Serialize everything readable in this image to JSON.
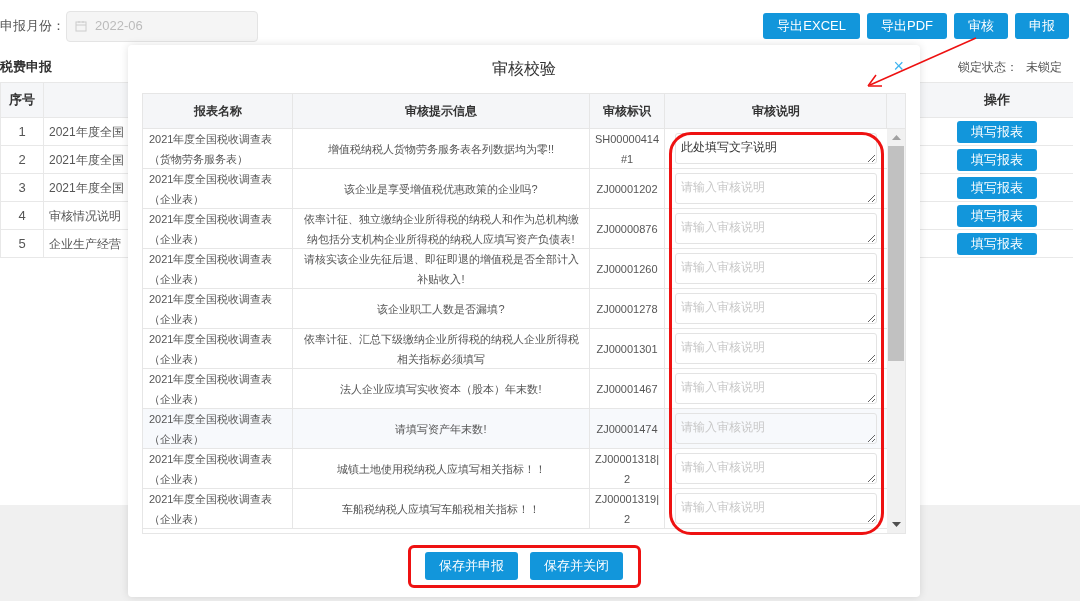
{
  "toolbar": {
    "month_label": "申报月份：",
    "month_value": "2022-06",
    "month_disabled": true,
    "buttons": [
      "导出EXCEL",
      "导出PDF",
      "审核",
      "申报"
    ]
  },
  "section_title": "税费申报",
  "lock": {
    "label": "锁定状态：",
    "value": "未锁定"
  },
  "main_table": {
    "columns": [
      "序号",
      "操作"
    ],
    "rows": [
      {
        "index": "1",
        "name": "2021年度全国",
        "action": "填写报表"
      },
      {
        "index": "2",
        "name": "2021年度全国",
        "action": "填写报表"
      },
      {
        "index": "3",
        "name": "2021年度全国",
        "action": "填写报表"
      },
      {
        "index": "4",
        "name": "审核情况说明",
        "action": "填写报表"
      },
      {
        "index": "5",
        "name": "企业生产经营",
        "action": "填写报表"
      }
    ]
  },
  "dialog": {
    "title": "审核校验",
    "close": "×",
    "columns": [
      "报表名称",
      "审核提示信息",
      "审核标识",
      "审核说明"
    ],
    "rows": [
      {
        "report": "2021年度全国税收调查表（货物劳务服务表）",
        "message": "增值税纳税人货物劳务服务表各列数据均为零!!",
        "code": "SH00000414#1",
        "note_value": "此处填写文字说明"
      },
      {
        "report": "2021年度全国税收调查表（企业表）",
        "message": "该企业是享受增值税优惠政策的企业吗?",
        "code": "ZJ00001202",
        "note_placeholder": "请输入审核说明"
      },
      {
        "report": "2021年度全国税收调查表（企业表）",
        "message": "依率计征、独立缴纳企业所得税的纳税人和作为总机构缴纳包括分支机构企业所得税的纳税人应填写资产负债表!",
        "code": "ZJ00000876",
        "note_placeholder": "请输入审核说明"
      },
      {
        "report": "2021年度全国税收调查表（企业表）",
        "message": "请核实该企业先征后退、即征即退的增值税是否全部计入补贴收入!",
        "code": "ZJ00001260",
        "note_placeholder": "请输入审核说明"
      },
      {
        "report": "2021年度全国税收调查表（企业表）",
        "message": "该企业职工人数是否漏填?",
        "code": "ZJ00001278",
        "note_placeholder": "请输入审核说明"
      },
      {
        "report": "2021年度全国税收调查表（企业表）",
        "message": "依率计征、汇总下级缴纳企业所得税的纳税人企业所得税相关指标必须填写",
        "code": "ZJ00001301",
        "note_placeholder": "请输入审核说明"
      },
      {
        "report": "2021年度全国税收调查表（企业表）",
        "message": "法人企业应填写实收资本（股本）年末数!",
        "code": "ZJ00001467",
        "note_placeholder": "请输入审核说明"
      },
      {
        "report": "2021年度全国税收调查表（企业表）",
        "message": "请填写资产年末数!",
        "code": "ZJ00001474",
        "note_placeholder": "请输入审核说明"
      },
      {
        "report": "2021年度全国税收调查表（企业表）",
        "message": "城镇土地使用税纳税人应填写相关指标！！",
        "code": "ZJ00001318|2",
        "note_placeholder": "请输入审核说明"
      },
      {
        "report": "2021年度全国税收调查表（企业表）",
        "message": "车船税纳税人应填写车船税相关指标！！",
        "code": "ZJ00001319|2",
        "note_placeholder": "请输入审核说明"
      }
    ],
    "buttons": [
      "保存并申报",
      "保存并关闭"
    ]
  }
}
